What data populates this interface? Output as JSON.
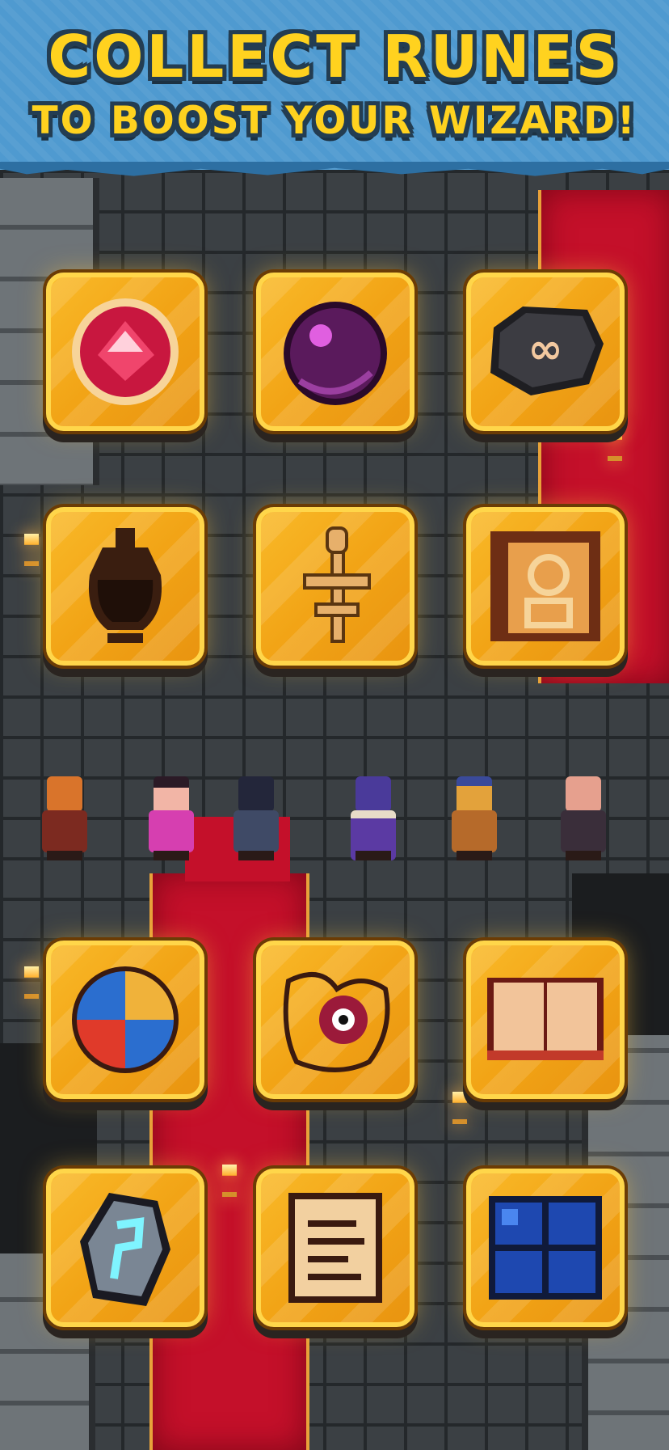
{
  "header": {
    "line1": "COLLECT RUNES",
    "line2": "TO BOOST YOUR WIZARD!"
  },
  "colors": {
    "banner": "#4f9ad0",
    "title": "#ffd21f",
    "tile": "#f2a416",
    "carpet": "#c4102a"
  },
  "runes": [
    {
      "id": "red-gem-rune",
      "icon": "red-gem-icon"
    },
    {
      "id": "dark-orb-rune",
      "icon": "purple-orb-icon"
    },
    {
      "id": "infinity-stone-rune",
      "icon": "infinity-stone-icon"
    },
    {
      "id": "urn-rune",
      "icon": "urn-icon"
    },
    {
      "id": "bone-key-rune",
      "icon": "bone-key-icon"
    },
    {
      "id": "portrait-rune",
      "icon": "portrait-icon"
    },
    {
      "id": "ball-rune",
      "icon": "beach-ball-icon"
    },
    {
      "id": "eye-map-rune",
      "icon": "eye-map-icon"
    },
    {
      "id": "book-rune",
      "icon": "open-book-icon"
    },
    {
      "id": "crystal-rune",
      "icon": "glowing-crystal-icon"
    },
    {
      "id": "scroll-rune",
      "icon": "scroll-icon"
    },
    {
      "id": "window-rune",
      "icon": "blue-window-icon"
    }
  ],
  "characters": [
    {
      "name": "cat-warrior"
    },
    {
      "name": "pink-mage"
    },
    {
      "name": "hooded-staff-mage"
    },
    {
      "name": "bearded-wizard"
    },
    {
      "name": "hat-ranger"
    },
    {
      "name": "bald-monk"
    }
  ]
}
